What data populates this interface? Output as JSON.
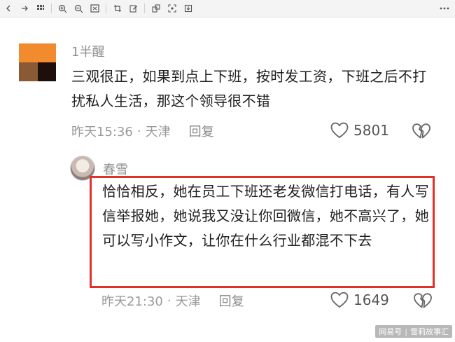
{
  "toolbar": {
    "icons": [
      "back-icon",
      "forward-icon",
      "grid-icon",
      "zoom-in-icon",
      "zoom-out-icon",
      "fit-screen-icon",
      "crop-icon",
      "edit-icon",
      "rotate-icon",
      "scan-icon",
      "download-icon",
      "more-icon"
    ]
  },
  "comment": {
    "username": "1半醒",
    "text": "三观很正，如果到点上下班，按时发工资，下班之后不打扰私人生活，那这个领导很不错",
    "time": "昨天15:36",
    "separator": "·",
    "location": "天津",
    "reply_label": "回复",
    "likes": "5801"
  },
  "reply": {
    "username": "春雪",
    "text": "恰恰相反，她在员工下班还老发微信打电话，有人写信举报她，她说我又没让你回微信，她不高兴了，她可以写小作文，让你在什么行业都混不下去",
    "time": "昨天21:30",
    "separator": "·",
    "location": "天津",
    "reply_label": "回复",
    "likes": "1649"
  },
  "highlight_color": "#e0322b",
  "avatar1_colors": [
    "#f28b2e",
    "#8a5a35",
    "#1d0f0c"
  ],
  "watermark": {
    "left": "网易号",
    "separator": "|",
    "right": "雪莉故事汇"
  }
}
